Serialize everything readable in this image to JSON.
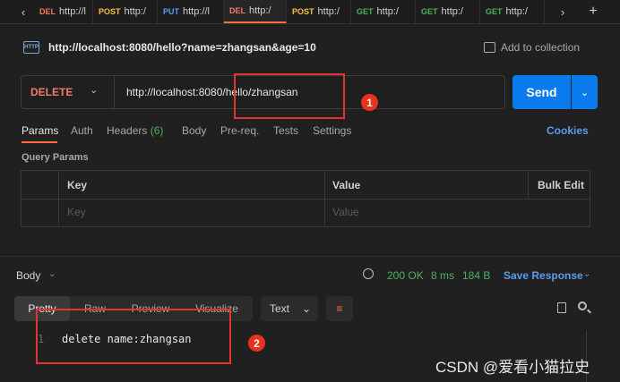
{
  "tabs": [
    {
      "method": "DEL",
      "method_color": "#f07a6a",
      "url": "http://l"
    },
    {
      "method": "POST",
      "method_color": "#f5c342",
      "url": "http:/"
    },
    {
      "method": "PUT",
      "method_color": "#5b9bef",
      "url": "http://l"
    },
    {
      "method": "DEL",
      "method_color": "#f07a6a",
      "url": "http:/"
    },
    {
      "method": "POST",
      "method_color": "#f5c342",
      "url": "http:/"
    },
    {
      "method": "GET",
      "method_color": "#49b35f",
      "url": "http:/"
    },
    {
      "method": "GET",
      "method_color": "#49b35f",
      "url": "http:/"
    },
    {
      "method": "GET",
      "method_color": "#49b35f",
      "url": "http:/"
    }
  ],
  "nav": {
    "prev": "‹",
    "next": "›",
    "new_tab": "+"
  },
  "request": {
    "icon_text": "HTTP",
    "title": "http://localhost:8080/hello?name=zhangsan&age=10",
    "add_to_collection": "Add to collection",
    "method": "DELETE",
    "url": "http://localhost:8080/hello/zhangsan",
    "send": "Send"
  },
  "request_tabs": {
    "params": "Params",
    "auth": "Auth",
    "headers": "Headers",
    "headers_count": "(6)",
    "body": "Body",
    "prereq": "Pre-req.",
    "tests": "Tests",
    "settings": "Settings",
    "cookies": "Cookies"
  },
  "query_params": {
    "title": "Query Params",
    "col_key": "Key",
    "col_value": "Value",
    "bulk_edit": "Bulk Edit",
    "key_placeholder": "Key",
    "value_placeholder": "Value"
  },
  "response": {
    "body_label": "Body",
    "status": "200 OK",
    "time": "8 ms",
    "size": "184 B",
    "save": "Save Response",
    "views": [
      "Pretty",
      "Raw",
      "Preview",
      "Visualize"
    ],
    "format": "Text",
    "line_number": "1",
    "content": "delete name:zhangsan"
  },
  "annotations": {
    "badge1": "1",
    "badge2": "2"
  },
  "watermark": "CSDN @爱看小猫拉史",
  "colors": {
    "accent": "#ff6c37",
    "send": "#097bed",
    "link": "#5b9bef",
    "success": "#49b35f",
    "delete": "#f07a6a",
    "annotation": "#e03531"
  }
}
